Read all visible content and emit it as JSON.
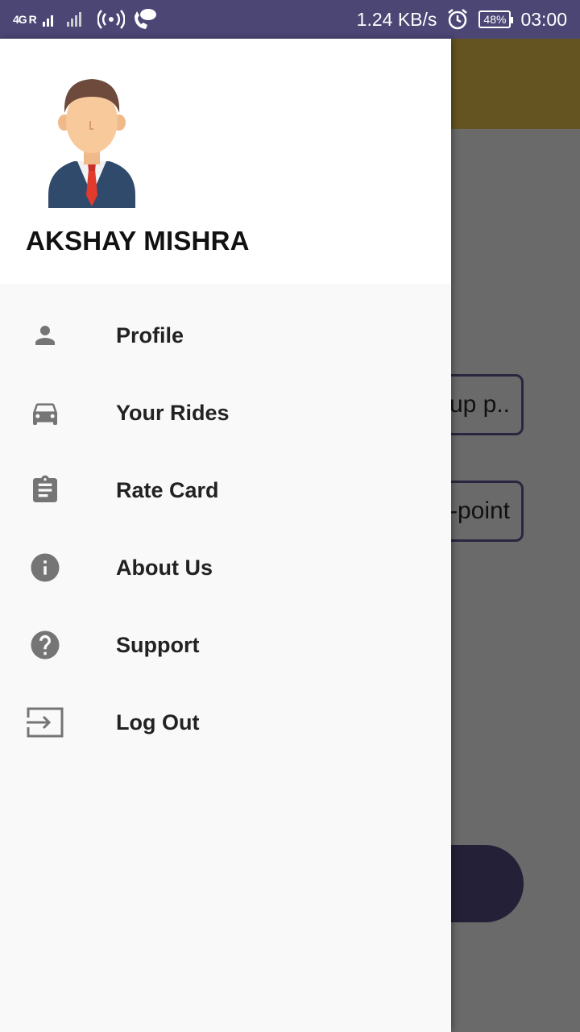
{
  "status_bar": {
    "network": "4G R",
    "speed": "1.24 KB/s",
    "battery": "48%",
    "time": "03:00"
  },
  "background": {
    "pickup_field_text": "up p..",
    "drop_field_text": "-point"
  },
  "drawer": {
    "user_name": "AKSHAY MISHRA",
    "menu": [
      {
        "label": "Profile",
        "icon": "person-icon"
      },
      {
        "label": "Your Rides",
        "icon": "car-icon"
      },
      {
        "label": "Rate Card",
        "icon": "clipboard-icon"
      },
      {
        "label": "About Us",
        "icon": "info-icon"
      },
      {
        "label": "Support",
        "icon": "help-icon"
      },
      {
        "label": "Log Out",
        "icon": "logout-icon"
      }
    ]
  },
  "colors": {
    "status_bar": "#4c4675",
    "icon_gray": "#757575",
    "scrim": "#6a6a6a"
  }
}
